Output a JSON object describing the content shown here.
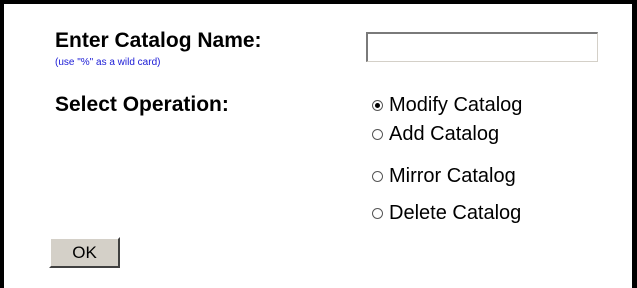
{
  "form": {
    "catalog_name_label": "Enter Catalog Name:",
    "wildcard_hint": "(use \"%\" as a wild card)",
    "catalog_name_value": "",
    "select_operation_label": "Select Operation:",
    "operations": [
      {
        "label": "Modify Catalog",
        "selected": true
      },
      {
        "label": "Add Catalog",
        "selected": false
      },
      {
        "label": "Mirror Catalog",
        "selected": false
      },
      {
        "label": "Delete Catalog",
        "selected": false
      }
    ],
    "ok_label": "OK"
  }
}
